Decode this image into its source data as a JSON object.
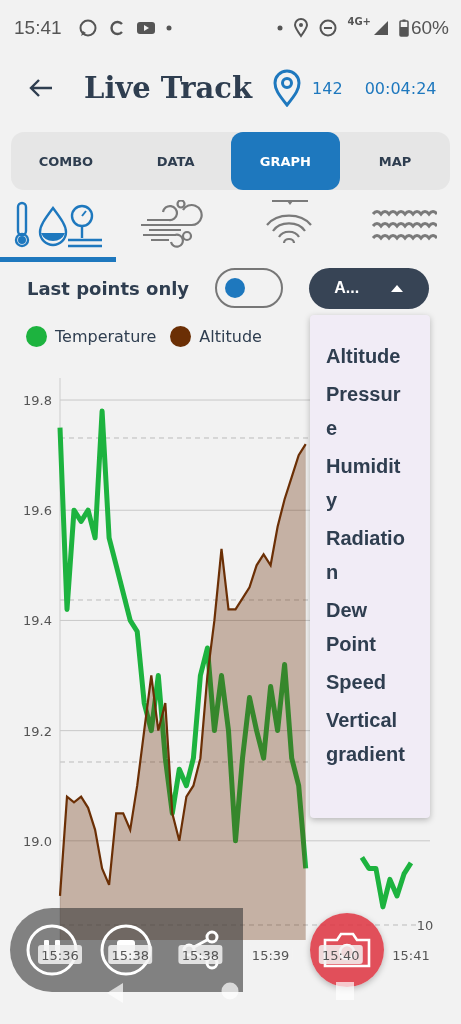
{
  "status_bar": {
    "time": "15:41",
    "network": "4G+",
    "battery": "60%"
  },
  "header": {
    "title": "Live Track",
    "points": "142",
    "elapsed": "00:04:24"
  },
  "tabs": [
    {
      "label": "COMBO",
      "selected": false
    },
    {
      "label": "DATA",
      "selected": false
    },
    {
      "label": "GRAPH",
      "selected": true
    },
    {
      "label": "MAP",
      "selected": false
    }
  ],
  "sensor_tabs": [
    {
      "kind": "climate",
      "selected": true
    },
    {
      "kind": "wind",
      "selected": false
    },
    {
      "kind": "signal",
      "selected": false
    },
    {
      "kind": "waves",
      "selected": false
    }
  ],
  "options": {
    "label": "Last points only",
    "on": false,
    "dropdown": {
      "value": "A...",
      "expanded": true
    }
  },
  "menu": {
    "items": [
      "Altitude",
      "Pressure",
      "Humidity",
      "Radiation",
      "Dew Point",
      "Speed",
      "Vertical gradient"
    ]
  },
  "chart": {
    "right_axis_label": "10",
    "chart_data": {
      "type": "line",
      "grid": true,
      "ylim": [
        18.82,
        19.84
      ],
      "categories": [
        "15:36",
        null,
        null,
        null,
        null,
        null,
        null,
        null,
        null,
        null,
        "15:38",
        null,
        null,
        null,
        null,
        null,
        null,
        null,
        null,
        null,
        "15:38",
        null,
        null,
        null,
        null,
        null,
        null,
        null,
        null,
        null,
        "15:39",
        null,
        null,
        null,
        null,
        null,
        null,
        null,
        null,
        null,
        "15:40",
        null,
        null,
        null,
        null,
        null,
        null,
        null,
        null,
        null,
        "15:41"
      ],
      "yticks": [
        {
          "value": 19.0,
          "label": "19.0"
        },
        {
          "value": 19.2,
          "label": "19.2"
        },
        {
          "value": 19.4,
          "label": "19.4"
        },
        {
          "value": 19.6,
          "label": "19.6"
        },
        {
          "value": 19.8,
          "label": "19.8"
        }
      ],
      "series": [
        {
          "name": "Temperature",
          "type": "line",
          "color": "#1db33f",
          "values": [
            19.75,
            19.42,
            19.6,
            19.58,
            19.6,
            19.55,
            19.78,
            19.55,
            19.5,
            19.45,
            19.4,
            19.38,
            19.25,
            19.2,
            19.3,
            19.15,
            19.05,
            19.13,
            19.1,
            19.15,
            19.3,
            19.35,
            19.2,
            19.3,
            19.2,
            19.0,
            19.15,
            19.26,
            19.2,
            19.15,
            19.28,
            19.2,
            19.32,
            19.15,
            19.1,
            18.95,
            null,
            null,
            null,
            null,
            null,
            null,
            null,
            18.97,
            18.95,
            18.95,
            18.88,
            18.93,
            18.9,
            18.94,
            18.96
          ]
        },
        {
          "name": "Altitude",
          "type": "area",
          "color": "#6b2f05",
          "values": [
            18.9,
            19.08,
            19.07,
            19.08,
            19.06,
            19.02,
            18.95,
            18.92,
            19.05,
            19.05,
            19.02,
            19.1,
            19.2,
            19.3,
            19.2,
            19.25,
            19.05,
            19.0,
            19.08,
            19.1,
            19.15,
            19.3,
            19.4,
            19.53,
            19.42,
            19.42,
            19.44,
            19.46,
            19.5,
            19.52,
            19.5,
            19.57,
            19.62,
            19.66,
            19.7,
            19.72,
            null,
            null,
            null,
            null,
            null,
            null,
            null,
            null,
            null,
            null,
            null,
            null,
            null,
            null,
            null
          ]
        }
      ]
    }
  },
  "controls": [
    {
      "kind": "pause"
    },
    {
      "kind": "stop"
    },
    {
      "kind": "share"
    }
  ]
}
